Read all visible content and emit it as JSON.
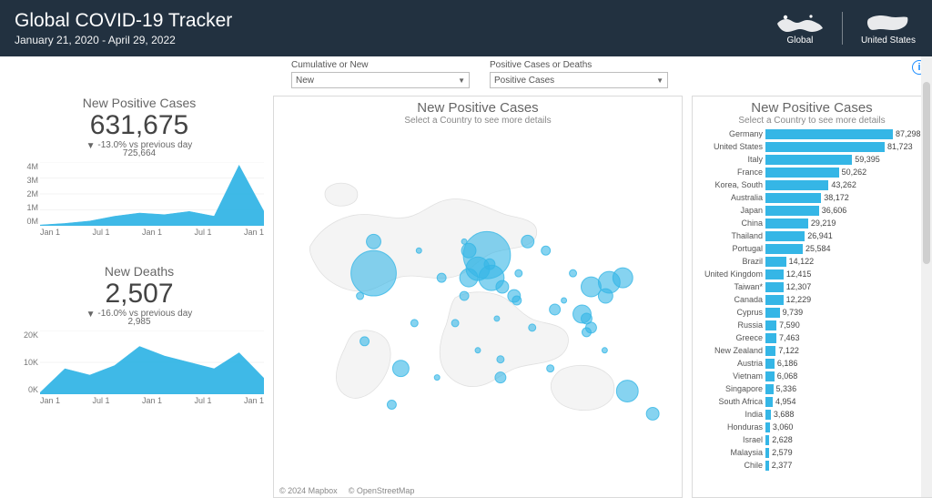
{
  "header": {
    "title": "Global COVID-19 Tracker",
    "date_range": "January 21, 2020 - April 29, 2022",
    "nav": {
      "global": "Global",
      "us": "United States"
    }
  },
  "filters": {
    "cumulative_label": "Cumulative or New",
    "cumulative_value": "New",
    "metric_label": "Positive Cases or Deaths",
    "metric_value": "Positive Cases"
  },
  "kpi": {
    "cases": {
      "title": "New Positive Cases",
      "value": "631,675",
      "delta_text": "-13.0% vs previous day",
      "prev_value": "725,664"
    },
    "deaths": {
      "title": "New Deaths",
      "value": "2,507",
      "delta_text": "-16.0% vs previous day",
      "prev_value": "2,985"
    }
  },
  "map": {
    "title": "New Positive Cases",
    "subtitle": "Select a Country to see more details",
    "foot_left": "© 2024 Mapbox",
    "foot_right": "© OpenStreetMap"
  },
  "bars": {
    "title": "New Positive Cases",
    "subtitle": "Select a Country to see more details"
  },
  "info_glyph": "i",
  "chart_data": {
    "country_bars": {
      "type": "bar",
      "orientation": "horizontal",
      "title": "New Positive Cases",
      "series": [
        {
          "name": "New Positive Cases",
          "data": [
            {
              "country": "Germany",
              "value": 87298
            },
            {
              "country": "United States",
              "value": 81723
            },
            {
              "country": "Italy",
              "value": 59395
            },
            {
              "country": "France",
              "value": 50262
            },
            {
              "country": "Korea, South",
              "value": 43262
            },
            {
              "country": "Australia",
              "value": 38172
            },
            {
              "country": "Japan",
              "value": 36606
            },
            {
              "country": "China",
              "value": 29219
            },
            {
              "country": "Thailand",
              "value": 26941
            },
            {
              "country": "Portugal",
              "value": 25584
            },
            {
              "country": "Brazil",
              "value": 14122
            },
            {
              "country": "United Kingdom",
              "value": 12415
            },
            {
              "country": "Taiwan*",
              "value": 12307
            },
            {
              "country": "Canada",
              "value": 12229
            },
            {
              "country": "Cyprus",
              "value": 9739
            },
            {
              "country": "Russia",
              "value": 7590
            },
            {
              "country": "Greece",
              "value": 7463
            },
            {
              "country": "New Zealand",
              "value": 7122
            },
            {
              "country": "Austria",
              "value": 6186
            },
            {
              "country": "Vietnam",
              "value": 6068
            },
            {
              "country": "Singapore",
              "value": 5336
            },
            {
              "country": "South Africa",
              "value": 4954
            },
            {
              "country": "India",
              "value": 3688
            },
            {
              "country": "Honduras",
              "value": 3060
            },
            {
              "country": "Israel",
              "value": 2628
            },
            {
              "country": "Malaysia",
              "value": 2579
            },
            {
              "country": "Chile",
              "value": 2377
            }
          ]
        }
      ]
    },
    "cases_trend": {
      "type": "area",
      "title": "New Positive Cases",
      "ylabel": "",
      "xlabel": "",
      "ylim": [
        0,
        4000000
      ],
      "y_ticks": [
        "4M",
        "3M",
        "2M",
        "1M",
        "0M"
      ],
      "x_ticks": [
        "Jan 1",
        "Jul 1",
        "Jan 1",
        "Jul 1",
        "Jan 1"
      ],
      "x": [
        "2020-01",
        "2020-04",
        "2020-07",
        "2020-10",
        "2021-01",
        "2021-04",
        "2021-07",
        "2021-10",
        "2022-01",
        "2022-04"
      ],
      "values": [
        50000,
        150000,
        300000,
        600000,
        800000,
        700000,
        900000,
        600000,
        3800000,
        900000
      ]
    },
    "deaths_trend": {
      "type": "area",
      "title": "New Deaths",
      "ylabel": "",
      "xlabel": "",
      "ylim": [
        0,
        20000
      ],
      "y_ticks": [
        "20K",
        "10K",
        "0K"
      ],
      "x_ticks": [
        "Jan 1",
        "Jul 1",
        "Jan 1",
        "Jul 1",
        "Jan 1"
      ],
      "x": [
        "2020-01",
        "2020-04",
        "2020-07",
        "2020-10",
        "2021-01",
        "2021-04",
        "2021-07",
        "2021-10",
        "2022-01",
        "2022-04"
      ],
      "values": [
        500,
        8000,
        6000,
        9000,
        15000,
        12000,
        10000,
        8000,
        13000,
        5000
      ]
    }
  }
}
